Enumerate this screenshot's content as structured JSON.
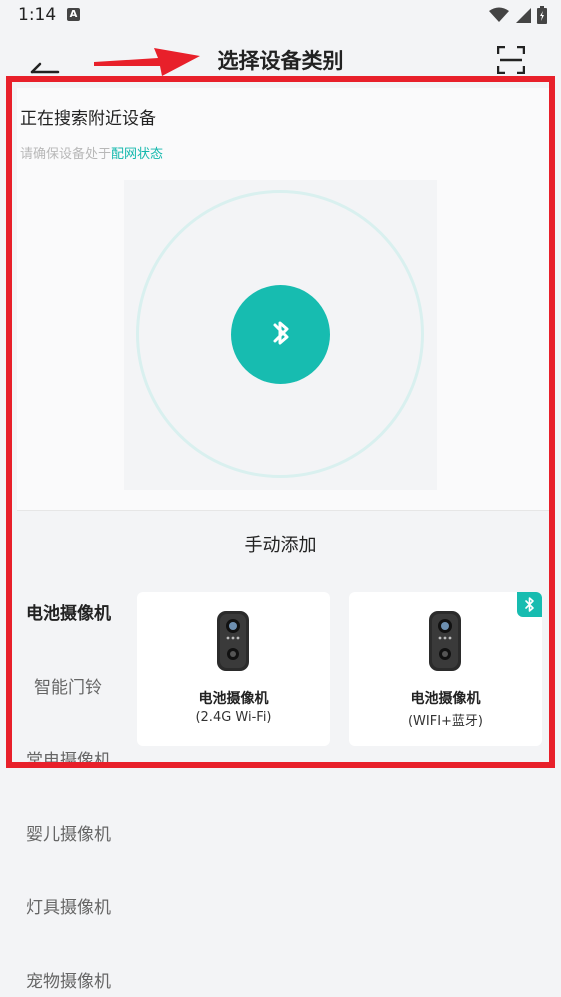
{
  "status": {
    "time": "1:14",
    "a_badge": "A"
  },
  "header": {
    "title": "选择设备类别"
  },
  "search": {
    "title": "正在搜索附近设备",
    "hint_prefix": "请确保设备处于",
    "hint_link": "配网状态"
  },
  "manual": {
    "label": "手动添加"
  },
  "categories": [
    {
      "label": "电池摄像机",
      "active": true
    },
    {
      "label": "智能门铃"
    },
    {
      "label": "常电摄像机"
    },
    {
      "label": "婴儿摄像机"
    },
    {
      "label": "灯具摄像机"
    },
    {
      "label": "宠物摄像机"
    }
  ],
  "devices": [
    {
      "name": "电池摄像机",
      "sub": "(2.4G Wi-Fi)",
      "bluetooth_badge": false
    },
    {
      "name": "电池摄像机",
      "sub": "(WIFI+蓝牙)",
      "bluetooth_badge": true
    }
  ],
  "colors": {
    "accent": "#17bcb0",
    "highlight": "#e8202a",
    "link": "#14b8ad"
  }
}
